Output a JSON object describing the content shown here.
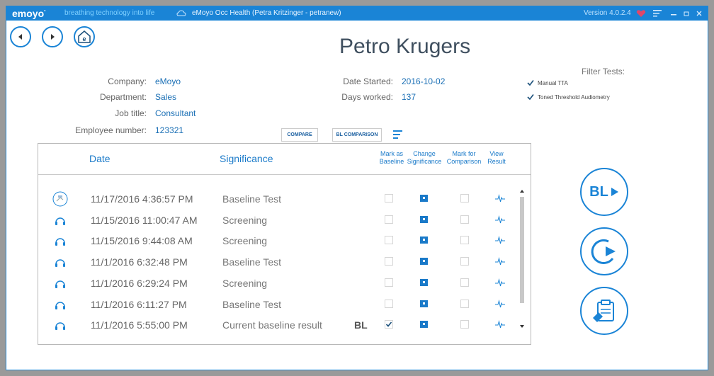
{
  "titlebar": {
    "logo": "emoyo",
    "tagline": "breathing technology into life",
    "title": "eMoyo Occ Health (Petra Kritzinger - petranew)",
    "version": "Version 4.0.2.4"
  },
  "patient": {
    "name": "Petro Krugers"
  },
  "info": {
    "company_label": "Company:",
    "company": "eMoyo",
    "department_label": "Department:",
    "department": "Sales",
    "jobtitle_label": "Job title:",
    "jobtitle": "Consultant",
    "employee_label": "Employee number:",
    "employee": "123321",
    "date_started_label": "Date Started:",
    "date_started": "2016-10-02",
    "days_worked_label": "Days worked:",
    "days_worked": "137"
  },
  "filter": {
    "title": "Filter Tests:",
    "items": [
      {
        "label": "Manual TTA",
        "checked": true
      },
      {
        "label": "Toned Threshold Audiometry",
        "checked": true
      }
    ]
  },
  "buttons": {
    "compare": "COMPARE",
    "bl_comparison": "BL COMPARISON",
    "bl_big": "BL"
  },
  "table": {
    "headers": {
      "date": "Date",
      "significance": "Significance",
      "mark_baseline_1": "Mark as",
      "mark_baseline_2": "Baseline",
      "change_sig_1": "Change",
      "change_sig_2": "Significance",
      "mark_comp_1": "Mark for",
      "mark_comp_2": "Comparison",
      "view_1": "View",
      "view_2": "Result"
    },
    "rows": [
      {
        "icon": "manual-test-icon",
        "date": "11/17/2016 4:36:57 PM",
        "significance": "Baseline Test",
        "bl": "",
        "baseline_checked": false
      },
      {
        "icon": "headphones-icon",
        "date": "11/15/2016 11:00:47 AM",
        "significance": "Screening",
        "bl": "",
        "baseline_checked": false
      },
      {
        "icon": "headphones-icon",
        "date": "11/15/2016 9:44:08 AM",
        "significance": "Screening",
        "bl": "",
        "baseline_checked": false
      },
      {
        "icon": "headphones-icon",
        "date": "11/1/2016 6:32:48 PM",
        "significance": "Baseline Test",
        "bl": "",
        "baseline_checked": false
      },
      {
        "icon": "headphones-icon",
        "date": "11/1/2016 6:29:24 PM",
        "significance": "Screening",
        "bl": "",
        "baseline_checked": false
      },
      {
        "icon": "headphones-icon",
        "date": "11/1/2016 6:11:27 PM",
        "significance": "Baseline Test",
        "bl": "",
        "baseline_checked": false
      },
      {
        "icon": "headphones-icon",
        "date": "11/1/2016 5:55:00 PM",
        "significance": "Current baseline result",
        "bl": "BL",
        "baseline_checked": true
      }
    ]
  },
  "colors": {
    "accent": "#1a84d6",
    "heart": "#e0476a"
  }
}
